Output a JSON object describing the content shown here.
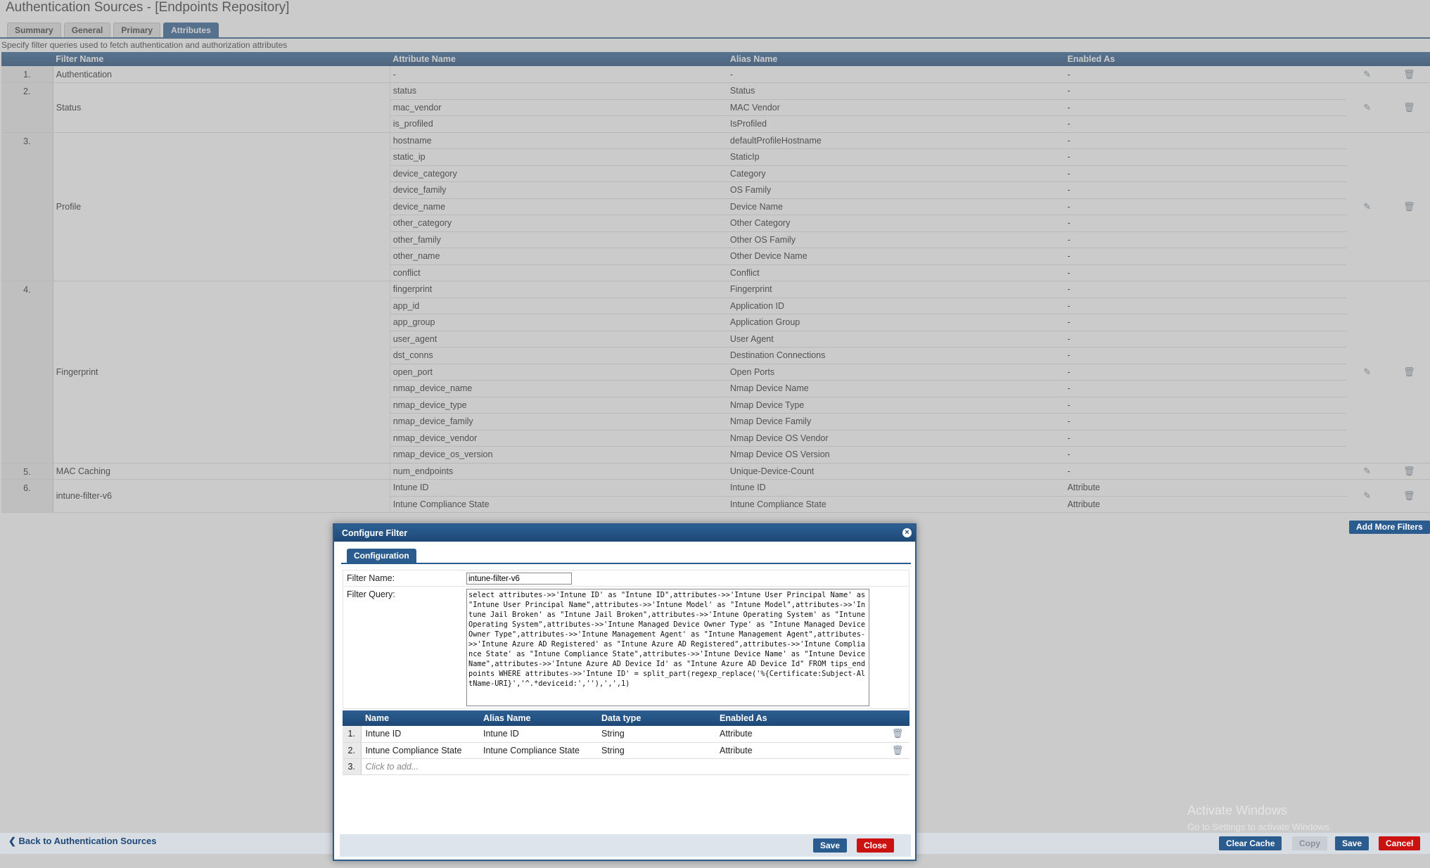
{
  "page": {
    "title": "Authentication Sources - [Endpoints Repository]",
    "tabs": [
      "Summary",
      "General",
      "Primary",
      "Attributes"
    ],
    "active_tab": "Attributes",
    "subtitle": "Specify filter queries used to fetch authentication and authorization attributes"
  },
  "attributes_table": {
    "headers": [
      "Filter Name",
      "Attribute Name",
      "Alias Name",
      "Enabled As"
    ],
    "filters": [
      {
        "num": "1.",
        "name": "Authentication",
        "rows": [
          [
            "-",
            "-",
            "-"
          ]
        ]
      },
      {
        "num": "2.",
        "name": "Status",
        "rows": [
          [
            "status",
            "Status",
            "-"
          ],
          [
            "mac_vendor",
            "MAC Vendor",
            "-"
          ],
          [
            "is_profiled",
            "IsProfiled",
            "-"
          ]
        ]
      },
      {
        "num": "3.",
        "name": "Profile",
        "rows": [
          [
            "hostname",
            "defaultProfileHostname",
            "-"
          ],
          [
            "static_ip",
            "StaticIp",
            "-"
          ],
          [
            "device_category",
            "Category",
            "-"
          ],
          [
            "device_family",
            "OS Family",
            "-"
          ],
          [
            "device_name",
            "Device Name",
            "-"
          ],
          [
            "other_category",
            "Other Category",
            "-"
          ],
          [
            "other_family",
            "Other OS Family",
            "-"
          ],
          [
            "other_name",
            "Other Device Name",
            "-"
          ],
          [
            "conflict",
            "Conflict",
            "-"
          ]
        ]
      },
      {
        "num": "4.",
        "name": "Fingerprint",
        "rows": [
          [
            "fingerprint",
            "Fingerprint",
            "-"
          ],
          [
            "app_id",
            "Application ID",
            "-"
          ],
          [
            "app_group",
            "Application Group",
            "-"
          ],
          [
            "user_agent",
            "User Agent",
            "-"
          ],
          [
            "dst_conns",
            "Destination Connections",
            "-"
          ],
          [
            "open_port",
            "Open Ports",
            "-"
          ],
          [
            "nmap_device_name",
            "Nmap Device Name",
            "-"
          ],
          [
            "nmap_device_type",
            "Nmap Device Type",
            "-"
          ],
          [
            "nmap_device_family",
            "Nmap Device Family",
            "-"
          ],
          [
            "nmap_device_vendor",
            "Nmap Device OS Vendor",
            "-"
          ],
          [
            "nmap_device_os_version",
            "Nmap Device OS Version",
            "-"
          ]
        ]
      },
      {
        "num": "5.",
        "name": "MAC Caching",
        "rows": [
          [
            "num_endpoints",
            "Unique-Device-Count",
            "-"
          ]
        ]
      },
      {
        "num": "6.",
        "name": "intune-filter-v6",
        "rows": [
          [
            "Intune ID",
            "Intune ID",
            "Attribute"
          ],
          [
            "Intune Compliance State",
            "Intune Compliance State",
            "Attribute"
          ]
        ]
      }
    ]
  },
  "buttons": {
    "add_more_filters": "Add More Filters",
    "back_link": "Back to Authentication Sources",
    "clear_cache": "Clear Cache",
    "copy": "Copy",
    "save": "Save",
    "cancel": "Cancel"
  },
  "watermark": {
    "line1": "Activate Windows",
    "line2": "Go to Settings to activate Windows."
  },
  "dialog": {
    "title": "Configure Filter",
    "tab": "Configuration",
    "filter_name_label": "Filter Name:",
    "filter_name_value": "intune-filter-v6",
    "filter_query_label": "Filter Query:",
    "filter_query_value": "select attributes->>'Intune ID' as \"Intune ID\",attributes->>'Intune User Principal Name' as \"Intune User Principal Name\",attributes->>'Intune Model' as \"Intune Model\",attributes->>'Intune Jail Broken' as \"Intune Jail Broken\",attributes->>'Intune Operating System' as \"Intune Operating System\",attributes->>'Intune Managed Device Owner Type' as \"Intune Managed Device Owner Type\",attributes->>'Intune Management Agent' as \"Intune Management Agent\",attributes->>'Intune Azure AD Registered' as \"Intune Azure AD Registered\",attributes->>'Intune Compliance State' as \"Intune Compliance State\",attributes->>'Intune Device Name' as \"Intune Device Name\",attributes->>'Intune Azure AD Device Id' as \"Intune Azure AD Device Id\" FROM tips_endpoints WHERE attributes->>'Intune ID' = split_part(regexp_replace('%{Certificate:Subject-AltName-URI}','^.*deviceid:',''),',',1)",
    "grid_headers": [
      "Name",
      "Alias Name",
      "Data type",
      "Enabled As"
    ],
    "grid_rows": [
      {
        "num": "1.",
        "name": "Intune ID",
        "alias": "Intune ID",
        "type": "String",
        "enabled": "Attribute"
      },
      {
        "num": "2.",
        "name": "Intune Compliance State",
        "alias": "Intune Compliance State",
        "type": "String",
        "enabled": "Attribute"
      }
    ],
    "click_to_add": {
      "num": "3.",
      "text": "Click to add..."
    },
    "save": "Save",
    "close": "Close"
  }
}
